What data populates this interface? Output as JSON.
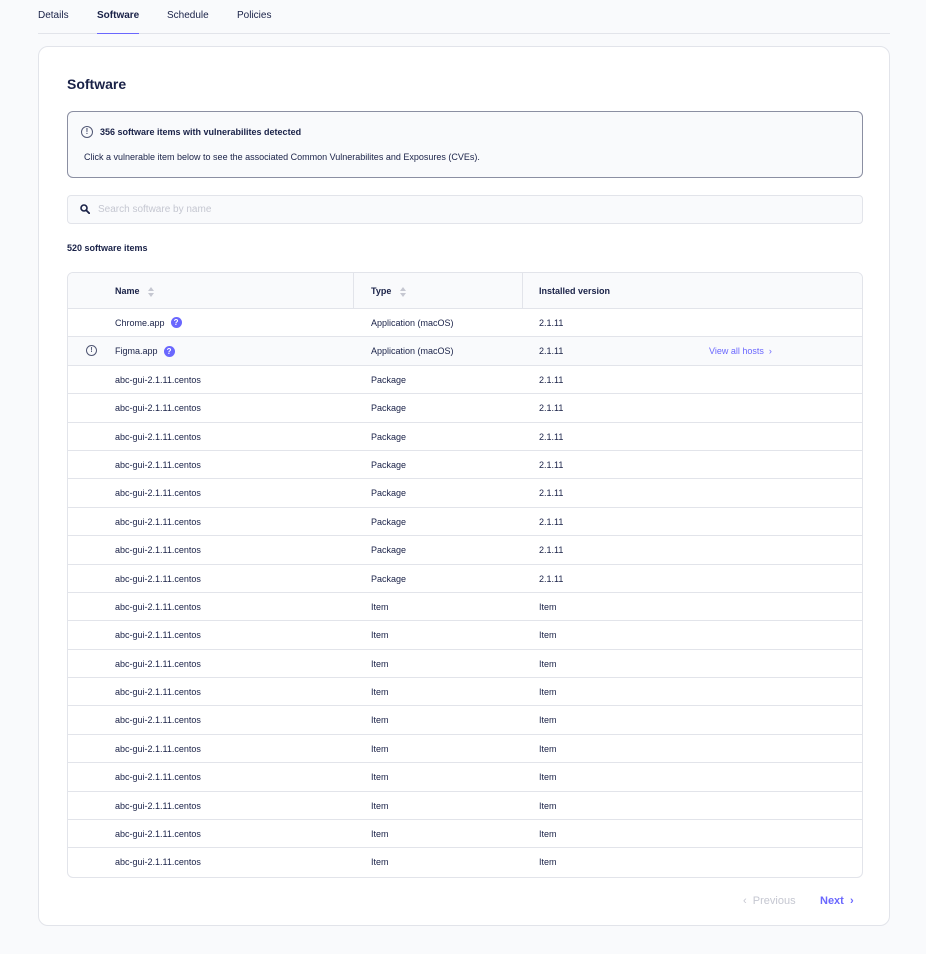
{
  "tabs": [
    "Details",
    "Software",
    "Schedule",
    "Policies"
  ],
  "page_title": "Software",
  "alert": {
    "title": "356 software items with vulnerabilites detected",
    "body": "Click a vulnerable item below to see the associated Common Vulnerabilites and Exposures (CVEs)."
  },
  "search": {
    "placeholder": "Search software by name"
  },
  "count_label": "520 software items",
  "table": {
    "columns": [
      "Name",
      "Type",
      "Installed version"
    ],
    "view_all_label": "View all hosts",
    "rows": [
      {
        "name": "Chrome.app",
        "type": "Application (macOS)",
        "version": "2.1.11"
      },
      {
        "name": "Figma.app",
        "type": "Application (macOS)",
        "version": "2.1.11"
      },
      {
        "name": "abc-gui-2.1.11.centos",
        "type": "Package",
        "version": "2.1.11"
      },
      {
        "name": "abc-gui-2.1.11.centos",
        "type": "Package",
        "version": "2.1.11"
      },
      {
        "name": "abc-gui-2.1.11.centos",
        "type": "Package",
        "version": "2.1.11"
      },
      {
        "name": "abc-gui-2.1.11.centos",
        "type": "Package",
        "version": "2.1.11"
      },
      {
        "name": "abc-gui-2.1.11.centos",
        "type": "Package",
        "version": "2.1.11"
      },
      {
        "name": "abc-gui-2.1.11.centos",
        "type": "Package",
        "version": "2.1.11"
      },
      {
        "name": "abc-gui-2.1.11.centos",
        "type": "Package",
        "version": "2.1.11"
      },
      {
        "name": "abc-gui-2.1.11.centos",
        "type": "Package",
        "version": "2.1.11"
      },
      {
        "name": "abc-gui-2.1.11.centos",
        "type": "Item",
        "version": "Item"
      },
      {
        "name": "abc-gui-2.1.11.centos",
        "type": "Item",
        "version": "Item"
      },
      {
        "name": "abc-gui-2.1.11.centos",
        "type": "Item",
        "version": "Item"
      },
      {
        "name": "abc-gui-2.1.11.centos",
        "type": "Item",
        "version": "Item"
      },
      {
        "name": "abc-gui-2.1.11.centos",
        "type": "Item",
        "version": "Item"
      },
      {
        "name": "abc-gui-2.1.11.centos",
        "type": "Item",
        "version": "Item"
      },
      {
        "name": "abc-gui-2.1.11.centos",
        "type": "Item",
        "version": "Item"
      },
      {
        "name": "abc-gui-2.1.11.centos",
        "type": "Item",
        "version": "Item"
      },
      {
        "name": "abc-gui-2.1.11.centos",
        "type": "Item",
        "version": "Item"
      },
      {
        "name": "abc-gui-2.1.11.centos",
        "type": "Item",
        "version": "Item"
      }
    ]
  },
  "pagination": {
    "previous_label": "Previous",
    "next_label": "Next"
  },
  "colors": {
    "accent": "#6a67fe",
    "text": "#192147",
    "border": "#e2e4ea",
    "muted": "#c5c7d1"
  },
  "icons": {
    "alert": "info-circle-icon",
    "search": "magnifier-icon",
    "help": "question-circle-icon",
    "sort": "sort-arrows-icon",
    "chevron": "chevron-right-icon"
  }
}
